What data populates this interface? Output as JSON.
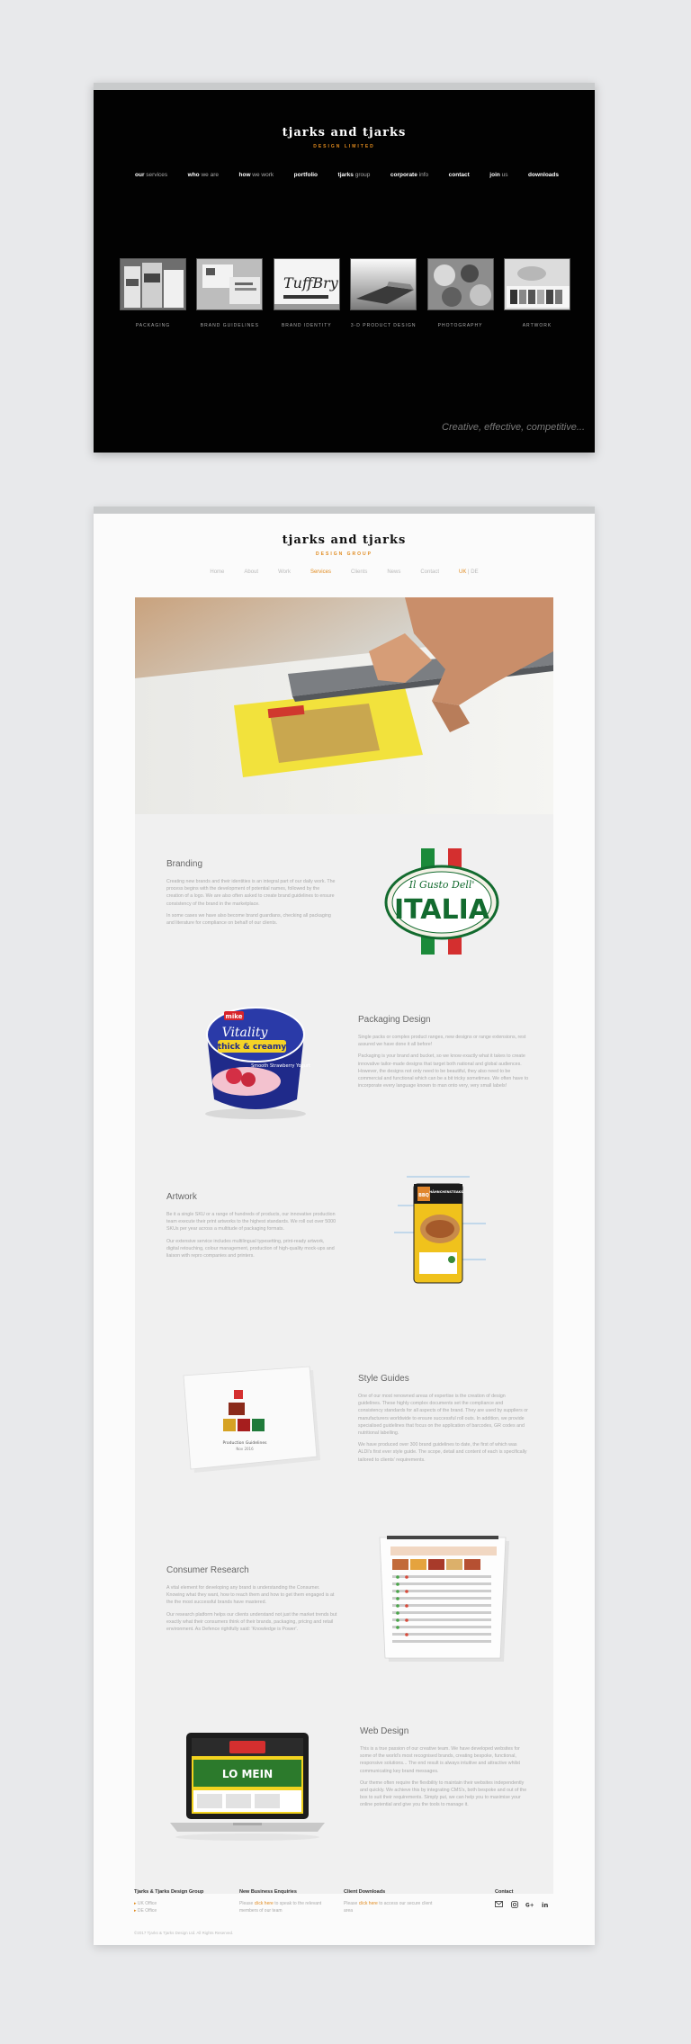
{
  "old_site": {
    "logo": "tjarks and tjarks",
    "tagline": "DESIGN LIMITED",
    "nav": [
      {
        "strong": "our",
        "rest": " services"
      },
      {
        "strong": "who",
        "rest": " we are"
      },
      {
        "strong": "how",
        "rest": " we work"
      },
      {
        "strong": "portfolio",
        "rest": ""
      },
      {
        "strong": "tjarks",
        "rest": " group"
      },
      {
        "strong": "corporate",
        "rest": " info"
      },
      {
        "strong": "contact",
        "rest": ""
      },
      {
        "strong": "join",
        "rest": " us"
      },
      {
        "strong": "downloads",
        "rest": ""
      }
    ],
    "tiles": [
      "PACKAGING",
      "BRAND GUIDELINES",
      "BRAND IDENTITY",
      "3-D PRODUCT DESIGN",
      "PHOTOGRAPHY",
      "ARTWORK"
    ],
    "slogan": "Creative, effective, competitive..."
  },
  "new_site": {
    "logo": "tjarks and tjarks",
    "tagline": "DESIGN GROUP",
    "nav": [
      "Home",
      "About",
      "Work",
      "Services",
      "Clients",
      "News",
      "Contact"
    ],
    "active_nav": "Services",
    "lang_active": "UK",
    "lang_sep": " | ",
    "lang_other": "DE",
    "sections": [
      {
        "title": "Branding",
        "paragraphs": [
          "Creating new brands and their identities is an integral part of our daily work. The process begins with the development of potential names, followed by the creation of a logo. We are also often asked to create brand guidelines to ensure consistency of the brand in the marketplace.",
          "In some cases we have also become brand guardians, checking all packaging and literature for compliance on behalf of our clients."
        ]
      },
      {
        "title": "Packaging Design",
        "paragraphs": [
          "Single packs or complex product ranges, new designs or range extensions, rest assured we have done it all before!",
          "Packaging is your brand and bucket, so we know exactly what it takes to create innovative tailor-made designs that target both national and global audiences. However, the designs not only need to be beautiful, they also need to be commercial and functional which can be a bit tricky sometimes. We often have to incorporate every language known to man onto very, very small labels!"
        ]
      },
      {
        "title": "Artwork",
        "paragraphs": [
          "Be it a single SKU or a range of hundreds of products, our innovative production team execute their print artworks to the highest standards. We roll out over 5000 SKUs per year across a multitude of packaging formats.",
          "Our extensive service includes multilingual typesetting, print-ready artwork, digital retouching, colour management, production of high-quality mock-ups and liaison with repro companies and printers."
        ]
      },
      {
        "title": "Style Guides",
        "paragraphs": [
          "One of our most renowned areas of expertise is the creation of design guidelines. These highly complex documents set the compliance and consistency standards for all aspects of the brand. They are used by suppliers or manufacturers worldwide to ensure successful roll outs. In addition, we provide specialised guidelines that focus on the application of barcodes, GR codes and nutritional labelling.",
          "We have produced over 300 brand guidelines to date, the first of which was ALDI's first ever style guide. The scope, detail and content of each is specifically tailored to clients' requirements."
        ]
      },
      {
        "title": "Consumer Research",
        "paragraphs": [
          "A vital element for developing any brand is understanding the Consumer. Knowing what they want, how to reach them and how to get them engaged is at the the most successful brands have mastered.",
          "Our research platform helps our clients understand not just the market trends but exactly what their consumers think of their brands, packaging, pricing and retail environment. As Defence rightfully said: 'Knowledge is Power'."
        ]
      },
      {
        "title": "Web Design",
        "paragraphs": [
          "This is a true passion of our creative team. We have developed websites for some of the world's most recognised brands, creating bespoke, functional, responsive solutions... The end result is always intuitive and attractive whilst communicating key brand messages.",
          "Our theme often require the flexibility to maintain their websites independently and quickly. We achieve this by integrating CMS's, both bespoke and out of the box to suit their requirements. Simply put, we can help you to maximise your online potential and give you the tools to manage it."
        ]
      }
    ],
    "product_texts": {
      "italia_script": "Il Gusto Dell'",
      "italia_word": "ITALIA",
      "yog_brand": "mike",
      "yog_line1": "Vitality",
      "yog_line2": "thick & creamy",
      "yog_flavor": "Smooth Strawberry Yogurt",
      "pouch_top": "BBQ",
      "pouch_name": "HÄHNCHENSTEAKS",
      "web_promo": "LO MEIN",
      "booklet_line": "Production Guidelines",
      "booklet_sub": "Nov 2016"
    },
    "footer": {
      "col1_title": "Tjarks & Tjarks Design Group",
      "col1_items": [
        "UK Office",
        "DE Office"
      ],
      "col2_title": "New Business Enquiries",
      "col2_text_a": "Please ",
      "col2_link": "click here",
      "col2_text_b": " to speak to the relevant members of our team",
      "col3_title": "Client Downloads",
      "col3_text_a": "Please ",
      "col3_link": "click here",
      "col3_text_b": " to access our secure client area",
      "col4_title": "Contact",
      "social_icons": [
        "mail-icon",
        "instagram-icon",
        "google-plus-icon",
        "linkedin-icon"
      ],
      "copyright": "©2017 Tjarks & Tjarks Design Ltd. All Rights Reserved."
    }
  },
  "colors": {
    "accent": "#e08a1e",
    "old_bg": "#020202",
    "page_bg": "#e8e9eb"
  }
}
